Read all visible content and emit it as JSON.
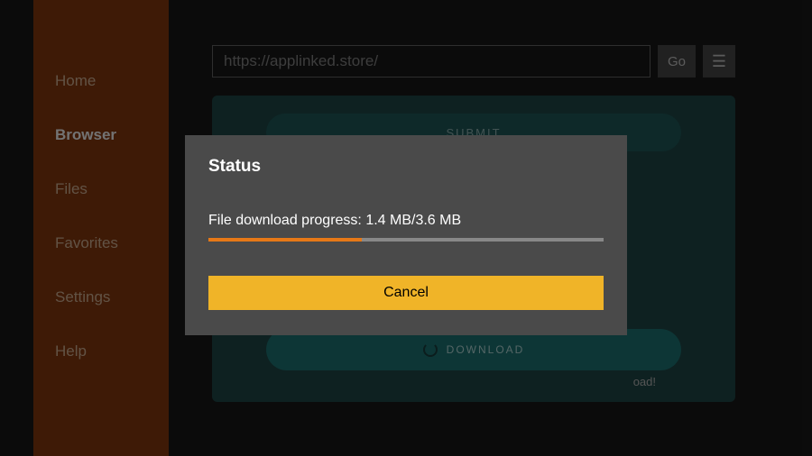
{
  "sidebar": {
    "items": [
      {
        "label": "Home",
        "active": false
      },
      {
        "label": "Browser",
        "active": true
      },
      {
        "label": "Files",
        "active": false
      },
      {
        "label": "Favorites",
        "active": false
      },
      {
        "label": "Settings",
        "active": false
      },
      {
        "label": "Help",
        "active": false
      }
    ]
  },
  "urlbar": {
    "value": "https://applinked.store/",
    "go_label": "Go",
    "menu_glyph": "☰"
  },
  "content": {
    "submit_label": "SUBMIT",
    "download_label": "DOWNLOAD",
    "extra_text": "oad!"
  },
  "dialog": {
    "title": "Status",
    "progress_text": "File download progress: 1.4 MB/3.6 MB",
    "progress_percent": 38.9,
    "cancel_label": "Cancel"
  },
  "colors": {
    "accent": "#e67817",
    "sidebar_bg": "#8b3a0f",
    "button_yellow": "#f0b428",
    "teal": "#1e7878"
  }
}
